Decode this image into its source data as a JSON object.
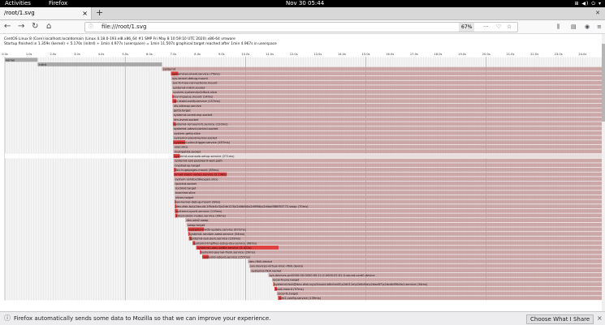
{
  "system_bar": {
    "activities": "Activities",
    "app_name": "Firefox",
    "clock": "Nov 30  05:44"
  },
  "browser": {
    "tab_title": "/root/1.svg",
    "url": "file:///root/1.svg",
    "zoom": "67%"
  },
  "doc": {
    "os_line": "CentOS Linux 8 (Core) localhost.localdomain (Linux 4.18.0-193.el8.x86_64 #1 SMP Fri May 8 10:59:10 UTC 2020) x86-64 vmware",
    "startup_line": "Startup finished in 1.359s (kernel) + 5.170s (initrd) + 1min 4.977s (userspace) = 1min 11.507s graphical.target reached after 1min 4.967s in userspace"
  },
  "chart_data": {
    "type": "bar",
    "title": "",
    "xlabel": "",
    "ylabel": "",
    "x_unit": "s",
    "x_ticks": [
      "0.0s",
      "1.0s",
      "2.0s",
      "3.0s",
      "4.0s",
      "5.0s",
      "6.0s",
      "7.0s",
      "8.0s",
      "9.0s",
      "10.0s",
      "11.0s",
      "12.0s",
      "13.0s",
      "14.0s",
      "15.0s",
      "16.0s",
      "17.0s",
      "18.0s",
      "19.0s",
      "20.0s",
      "21.0s",
      "22.0s",
      "23.0s",
      "24.0s"
    ],
    "xlim": [
      0,
      24.8
    ],
    "grid": true,
    "rows": [
      {
        "label": "kernel",
        "start": 0.0,
        "end": 1.36,
        "kind": "kernel"
      },
      {
        "label": "initrd",
        "start": 1.36,
        "end": 6.53,
        "kind": "kernel"
      },
      {
        "label": "systemd",
        "start": 6.53,
        "end": 24.8,
        "active": 0
      },
      {
        "label": "systemd-journald.service (75ms)",
        "start": 6.9,
        "end": 24.8,
        "active": 0.3
      },
      {
        "label": "sys-kernel-debug.mount",
        "start": 6.92,
        "end": 24.8,
        "active": 0
      },
      {
        "label": "sys-fs-fuse-connections.mount",
        "start": 6.93,
        "end": 24.8,
        "active": 0
      },
      {
        "label": "systemd-initctl.socket",
        "start": 6.94,
        "end": 24.8,
        "active": 0
      },
      {
        "label": "system-systemd\\x2dfsck.slice",
        "start": 6.95,
        "end": 24.8,
        "active": 0
      },
      {
        "label": "dev-mqueue.mount (14ms)",
        "start": 6.95,
        "end": 24.8,
        "active": 0.05
      },
      {
        "label": "rpc-statd-notify.service (157ms)",
        "start": 6.96,
        "end": 24.8,
        "active": 0.16
      },
      {
        "label": "nfs-blkmap.service",
        "start": 6.97,
        "end": 24.8,
        "active": 0
      },
      {
        "label": "getty.target",
        "start": 6.97,
        "end": 24.8,
        "active": 0
      },
      {
        "label": "systemd-coredump.socket",
        "start": 6.97,
        "end": 24.8,
        "active": 0
      },
      {
        "label": "dm-event.socket",
        "start": 6.98,
        "end": 24.8,
        "active": 0
      },
      {
        "label": "systemd-remount-fs.service (120ms)",
        "start": 6.98,
        "end": 24.8,
        "active": 0.12
      },
      {
        "label": "systemd-udevd-control.socket",
        "start": 6.98,
        "end": 24.8,
        "active": 0
      },
      {
        "label": "system-getty.slice",
        "start": 6.99,
        "end": 24.8,
        "active": 0
      },
      {
        "label": "systemd-udevd-kernel.socket",
        "start": 6.99,
        "end": 24.8,
        "active": 0
      },
      {
        "label": "systemd-udev-trigger.service (497ms)",
        "start": 6.99,
        "end": 24.8,
        "active": 0.5
      },
      {
        "label": "user.slice",
        "start": 7.0,
        "end": 24.8,
        "active": 0
      },
      {
        "label": "multipathd.socket",
        "start": 7.0,
        "end": 24.8,
        "active": 0
      },
      {
        "label": "systemd-vconsole-setup.service (271ms)",
        "start": 7.0,
        "end": 24.8,
        "active": 0.27
      },
      {
        "label": "systemd-ask-password-wall.path",
        "start": 7.01,
        "end": 24.8,
        "active": 0
      },
      {
        "label": "cryptsetup.target",
        "start": 7.01,
        "end": 24.8,
        "active": 0
      },
      {
        "label": "dev-hugepages.mount (85ms)",
        "start": 7.02,
        "end": 24.8,
        "active": 0.085
      },
      {
        "label": "kmod-static-nodes.service (2.196s)",
        "start": 7.02,
        "end": 24.8,
        "active": 2.2
      },
      {
        "label": "system-sshd\\x2dkeygen.slice",
        "start": 7.03,
        "end": 24.8,
        "active": 0
      },
      {
        "label": "rpcbind.socket",
        "start": 7.03,
        "end": 24.8,
        "active": 0
      },
      {
        "label": "rpcbind.target",
        "start": 7.04,
        "end": 24.8,
        "active": 0
      },
      {
        "label": "machine.slice",
        "start": 7.04,
        "end": 24.8,
        "active": 0
      },
      {
        "label": "slices.target",
        "start": 7.05,
        "end": 24.8,
        "active": 0
      },
      {
        "label": "sys-kernel-debug.mount (6ms)",
        "start": 7.05,
        "end": 24.8,
        "active": 0.02
      },
      {
        "label": "dev-disk-by\\x2duuid-1f9cb4c3\\x2de123\\x2d4b6d\\x2d9f6b\\x2d4ad586f53772.swap (70ms)",
        "start": 7.06,
        "end": 24.8,
        "active": 0.07
      },
      {
        "label": "systemd-sysctl.service (119ms)",
        "start": 7.06,
        "end": 24.8,
        "active": 0.12
      },
      {
        "label": "kmod-static-nodes.service (99ms)",
        "start": 7.07,
        "end": 24.8,
        "active": 0.1
      },
      {
        "label": "dev-sda2.swap",
        "start": 7.5,
        "end": 24.8,
        "active": 0
      },
      {
        "label": "swap.target",
        "start": 7.55,
        "end": 24.8,
        "active": 0
      },
      {
        "label": "systemd-hwdb-update.service (672ms)",
        "start": 7.6,
        "end": 24.8,
        "active": 0.67
      },
      {
        "label": "systemd-random-seed.service (54ms)",
        "start": 7.62,
        "end": 24.8,
        "active": 0.05
      },
      {
        "label": "systemd-sysusers.service (109ms)",
        "start": 7.65,
        "end": 24.8,
        "active": 0.11
      },
      {
        "label": "systemd-tmpfiles-setup-dev.service (98ms)",
        "start": 7.8,
        "end": 24.8,
        "active": 0.1
      },
      {
        "label": "systemd-udev-settle.service (3.421s)",
        "start": 7.95,
        "end": 24.8,
        "active": 3.42
      },
      {
        "label": "systemd-journal-flush.service (29ms)",
        "start": 8.1,
        "end": 24.8,
        "active": 0.03
      },
      {
        "label": "systemd-udevd.service (257ms)",
        "start": 8.2,
        "end": 24.8,
        "active": 0.26
      },
      {
        "label": "dev-rfkill.device",
        "start": 10.1,
        "end": 24.8,
        "active": 0
      },
      {
        "label": "sys-devices-virtual-misc-rfkill.device",
        "start": 10.15,
        "end": 24.8,
        "active": 0
      },
      {
        "label": "systemd-rfkill.socket",
        "start": 10.2,
        "end": 24.8,
        "active": 0
      },
      {
        "label": "sys-devices-pci0000:00-0000:00:11.0-0000:02:02.0-sound-card0.device",
        "start": 10.95,
        "end": 24.8,
        "active": 0
      },
      {
        "label": "local-fs-pre.target",
        "start": 11.1,
        "end": 24.8,
        "active": 0
      },
      {
        "label": "systemd-fsck@dev-disk-by\\x2duuid-b8cfce45\\x2d011e\\x2d4d5a\\x2dae87\\x2dcdb99b0a1.service (34ms)",
        "start": 11.15,
        "end": 24.8,
        "active": 0.03
      },
      {
        "label": "boot.mount (97ms)",
        "start": 11.2,
        "end": 24.8,
        "active": 0.1
      },
      {
        "label": "local-fs.target",
        "start": 11.3,
        "end": 24.8,
        "active": 0
      },
      {
        "label": "lvm2-config.service (139ms)",
        "start": 11.35,
        "end": 24.8,
        "active": 0.14
      }
    ],
    "colors": {
      "activating_bar": "#c49a9a",
      "active_highlight": "#e04040",
      "kernel_bar": "#a8a8a8",
      "selected_row": "#ffffff",
      "grid": "#d4d4d4"
    }
  }
}
